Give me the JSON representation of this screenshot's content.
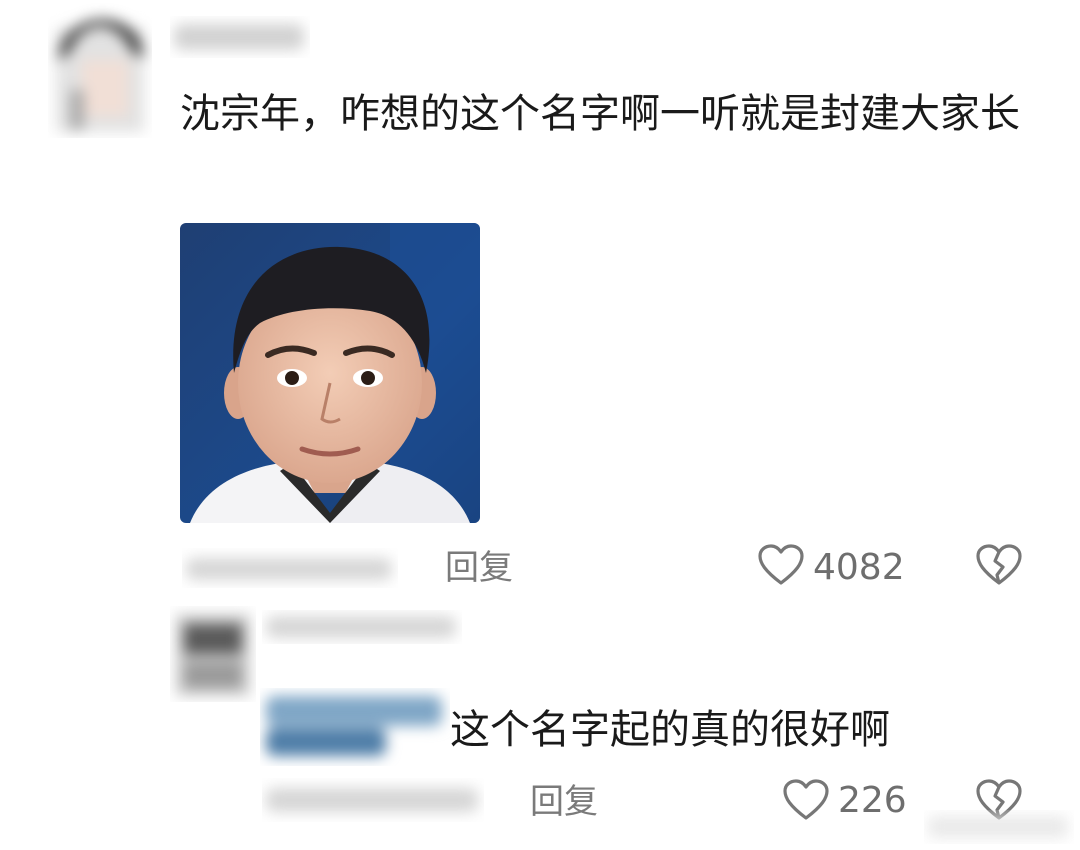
{
  "comment": {
    "text": "沈宗年，咋想的这个名字啊一听就是封建大家长",
    "reply_label": "回复",
    "like_count": "4082"
  },
  "reply": {
    "text": "这个名字起的真的很好啊",
    "reply_label": "回复",
    "like_count": "226"
  },
  "icons": {
    "like": "heart-outline-icon",
    "dislike": "broken-heart-icon"
  }
}
